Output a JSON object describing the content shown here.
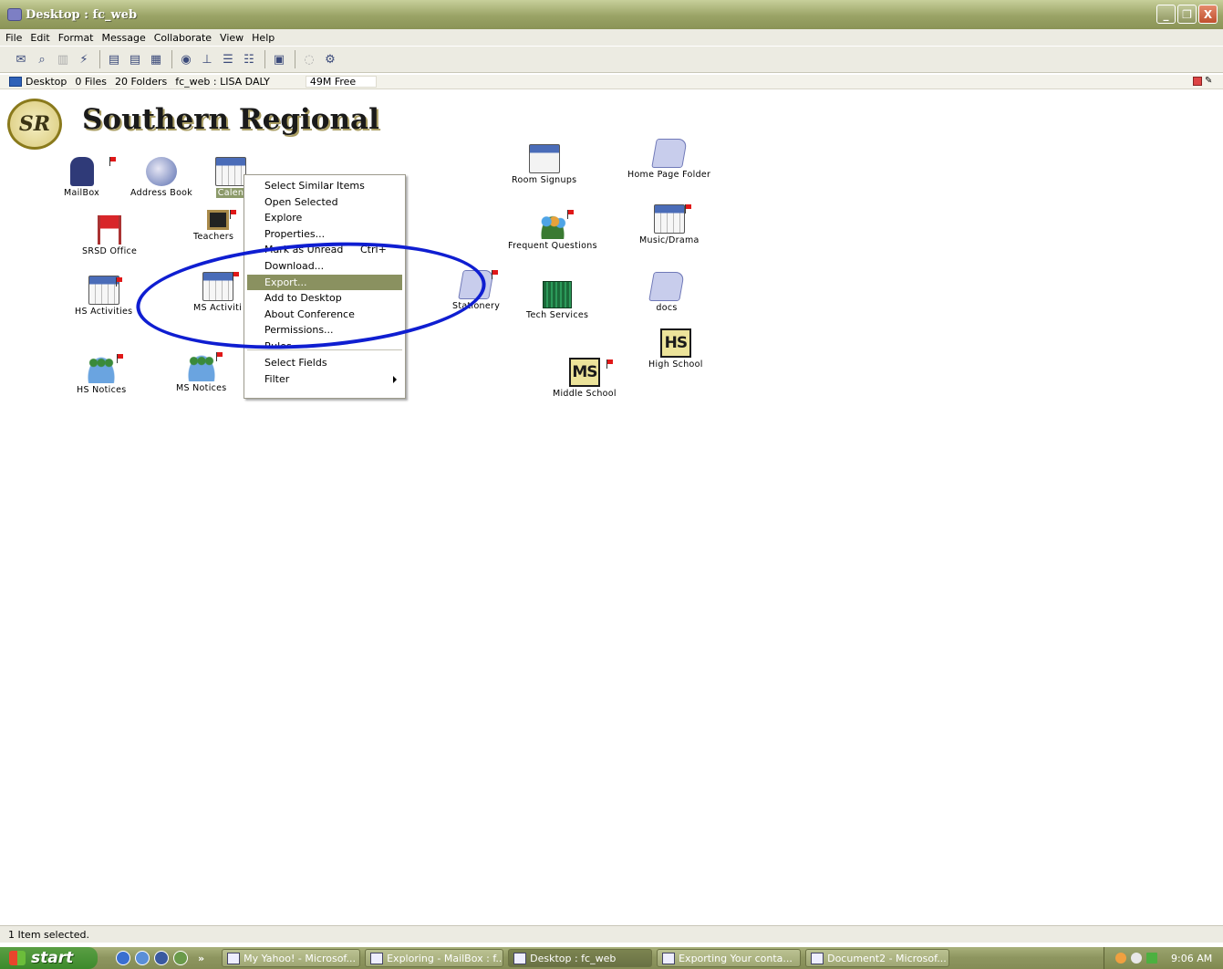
{
  "window": {
    "title": "Desktop : fc_web",
    "buttons": [
      "_",
      "❐",
      "X"
    ]
  },
  "menubar": [
    "File",
    "Edit",
    "Format",
    "Message",
    "Collaborate",
    "View",
    "Help"
  ],
  "toolbar_icons": [
    "new-message-icon",
    "find-icon",
    "delete-icon",
    "connect-icon",
    "new-folder-icon",
    "new-conference-icon",
    "folder-properties-icon",
    "calendar-icon",
    "filter-icon",
    "sort-icon",
    "people-icon",
    "open-conference-icon",
    "disabled-icon",
    "network-icon"
  ],
  "infobar": {
    "location": "Desktop",
    "files": "0 Files",
    "folders": "20 Folders",
    "user": "fc_web : LISA DALY",
    "free": "49M Free"
  },
  "logo": {
    "initials": "SR",
    "name": "Southern Regional"
  },
  "desktop_icons": [
    {
      "id": "mailbox",
      "label": "MailBox",
      "glyph": "g-mail",
      "flag": true
    },
    {
      "id": "address-book",
      "label": "Address Book",
      "glyph": "g-book",
      "flag": false
    },
    {
      "id": "calendar",
      "label": "Calen",
      "glyph": "g-cal",
      "flag": false,
      "selected": true
    },
    {
      "id": "srsd-office",
      "label": "SRSD Office",
      "glyph": "g-chair",
      "flag": false
    },
    {
      "id": "teachers",
      "label": "Teachers",
      "glyph": "g-board",
      "flag": true
    },
    {
      "id": "hs-activities",
      "label": "HS Activities",
      "glyph": "g-cal",
      "flag": true
    },
    {
      "id": "ms-activities",
      "label": "MS Activiti",
      "glyph": "g-cal",
      "flag": true
    },
    {
      "id": "hs-notices",
      "label": "HS Notices",
      "glyph": "g-notice",
      "flag": true
    },
    {
      "id": "ms-notices",
      "label": "MS Notices",
      "glyph": "g-notice",
      "flag": true
    },
    {
      "id": "stationery",
      "label": "Stationery",
      "glyph": "g-folder",
      "flag": true
    },
    {
      "id": "room-signups",
      "label": "Room Signups",
      "glyph": "g-room",
      "flag": false
    },
    {
      "id": "frequent-questions",
      "label": "Frequent Questions",
      "glyph": "g-people",
      "flag": true
    },
    {
      "id": "tech-services",
      "label": "Tech Services",
      "glyph": "g-chip",
      "flag": false
    },
    {
      "id": "middle-school",
      "label": "Middle School",
      "glyph": "g-ms",
      "glyph_text": "MS",
      "flag": true
    },
    {
      "id": "home-page-folder",
      "label": "Home Page Folder",
      "glyph": "g-folder",
      "flag": false
    },
    {
      "id": "music-drama",
      "label": "Music/Drama",
      "glyph": "g-cal",
      "flag": true
    },
    {
      "id": "docs",
      "label": "docs",
      "glyph": "g-folder",
      "flag": false
    },
    {
      "id": "high-school",
      "label": "High School",
      "glyph": "g-hs",
      "glyph_text": "HS",
      "flag": false
    }
  ],
  "context_menu": {
    "items": [
      {
        "label": "Select Similar Items"
      },
      {
        "label": "Open Selected"
      },
      {
        "label": "Explore"
      },
      {
        "label": "Properties..."
      },
      {
        "label": "Mark as Unread",
        "shortcut": "Ctrl+"
      },
      {
        "label": "Download..."
      },
      {
        "label": "Export...",
        "highlighted": true
      },
      {
        "label": "Add to Desktop"
      },
      {
        "label": "About Conference"
      },
      {
        "label": "Permissions..."
      },
      {
        "label": "Rules",
        "clipped": true
      },
      {
        "separator": true
      },
      {
        "label": "Select Fields"
      },
      {
        "label": "Filter",
        "submenu": true
      }
    ]
  },
  "statusbar": {
    "text": "1 Item selected."
  },
  "taskbar": {
    "start_label": "start",
    "quicklaunch_more": "»",
    "tasks": [
      {
        "label": "My Yahoo! - Microsof...",
        "active": false
      },
      {
        "label": "Exploring - MailBox : f...",
        "active": false
      },
      {
        "label": "Desktop : fc_web",
        "active": true
      },
      {
        "label": "Exporting Your conta...",
        "active": false
      },
      {
        "label": "Document2 - Microsof...",
        "active": false
      }
    ],
    "clock": "9:06 AM"
  }
}
